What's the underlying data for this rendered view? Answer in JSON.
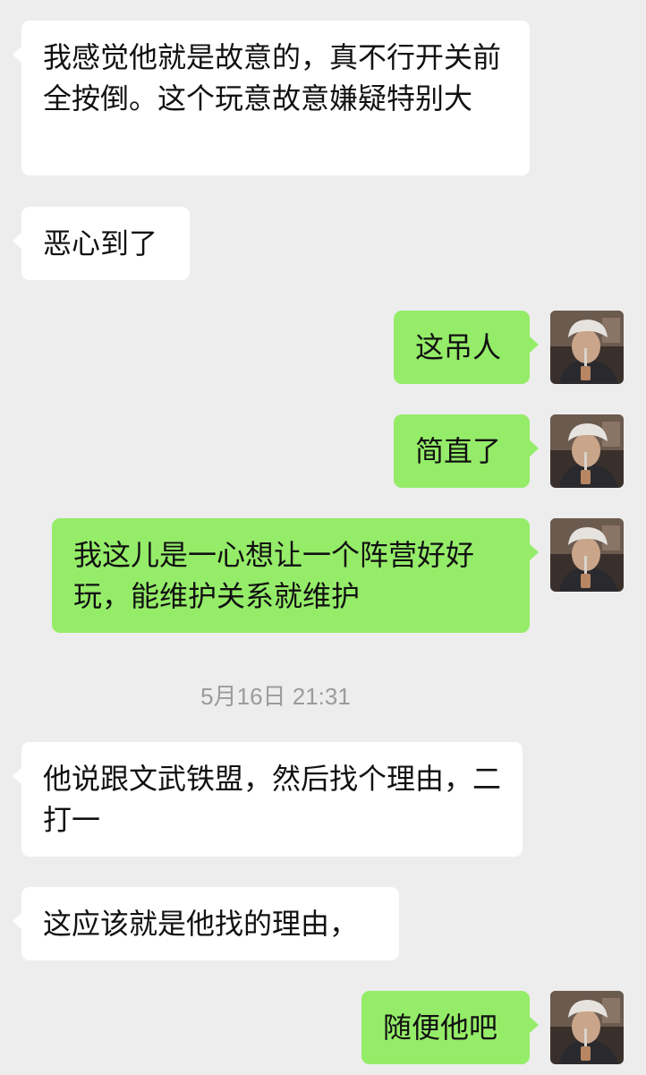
{
  "messages": [
    {
      "side": "left",
      "text": "我感觉他就是故意的，真不行开关前全按倒。这个玩意故意嫌疑特别大"
    },
    {
      "side": "left",
      "text": "恶心到了"
    },
    {
      "side": "right",
      "text": "这吊人"
    },
    {
      "side": "right",
      "text": "简直了"
    },
    {
      "side": "right",
      "text": "我这儿是一心想让一个阵营好好玩，能维护关系就维护"
    },
    {
      "side": "left",
      "text": "他说跟文武铁盟，然后找个理由，二打一"
    },
    {
      "side": "left",
      "text": "这应该就是他找的理由，"
    },
    {
      "side": "right",
      "text": "随便他吧"
    }
  ],
  "timestamp": "5月16日 21:31",
  "colors": {
    "background": "#ededed",
    "bubble_left": "#ffffff",
    "bubble_right": "#95ec69",
    "timestamp_text": "#9b9b9b"
  },
  "icons": {
    "avatar": "user-avatar-photo"
  }
}
